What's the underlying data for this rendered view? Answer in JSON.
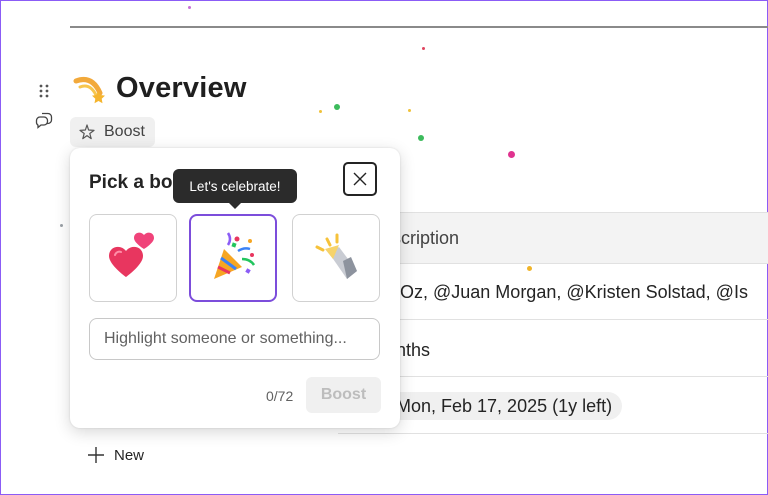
{
  "page": {
    "title": "Overview",
    "boost_label": "Boost"
  },
  "table": {
    "header": "escription",
    "rows": [
      {
        "text": "y Oz, @Juan Morgan, @Kristen Solstad, @Is"
      },
      {
        "text": "nths"
      },
      {
        "text": "Mon, Feb 17, 2025 (1y left)"
      }
    ],
    "new_label": "New"
  },
  "boost_popup": {
    "title": "Pick a boo",
    "tooltip": "Let's celebrate!",
    "options": [
      {
        "icon": "two-hearts-icon"
      },
      {
        "icon": "party-popper-icon",
        "selected": true
      },
      {
        "icon": "flashlight-icon"
      }
    ],
    "input_placeholder": "Highlight someone or something...",
    "counter": "0/72",
    "submit_label": "Boost"
  },
  "colors": {
    "selected_border": "#7c4ddb",
    "tooltip_bg": "#2b2b2b",
    "frame_accent": "#8b5cf6"
  }
}
